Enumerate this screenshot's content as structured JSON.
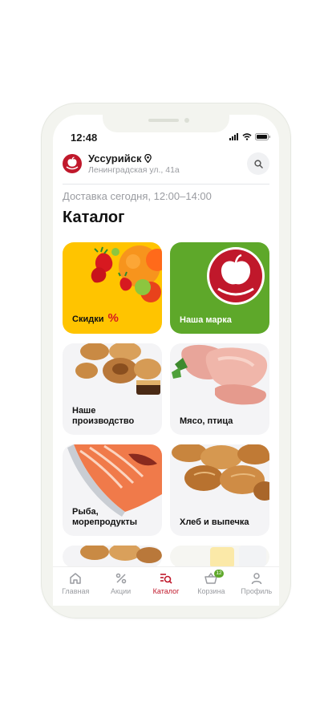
{
  "status": {
    "time": "12:48"
  },
  "header": {
    "city": "Уссурийск",
    "address": "Ленинградская ул., 41а"
  },
  "delivery_text": "Доставка сегодня, 12:00–14:00",
  "page_title": "Каталог",
  "categories": [
    {
      "label": "Скидки",
      "extra": "%"
    },
    {
      "label": "Наша марка"
    },
    {
      "label": "Наше производство"
    },
    {
      "label": "Мясо, птица"
    },
    {
      "label": "Рыба, морепродукты"
    },
    {
      "label": "Хлеб и выпечка"
    }
  ],
  "tabbar": {
    "items": [
      {
        "label": "Главная",
        "icon": "home-icon"
      },
      {
        "label": "Акции",
        "icon": "percent-icon"
      },
      {
        "label": "Каталог",
        "icon": "catalog-icon"
      },
      {
        "label": "Корзина",
        "icon": "basket-icon"
      },
      {
        "label": "Профиль",
        "icon": "profile-icon"
      }
    ],
    "active_index": 2,
    "cart_badge": "12"
  },
  "colors": {
    "brand_red": "#c0182b",
    "brand_green": "#5ea82a",
    "sale_yellow": "#ffc400",
    "muted_text": "#9a9ca1"
  }
}
